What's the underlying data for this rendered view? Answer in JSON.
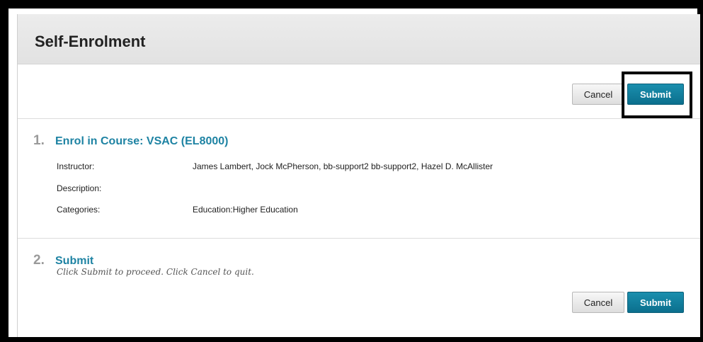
{
  "page": {
    "title": "Self-Enrolment"
  },
  "top_actions": {
    "cancel_label": "Cancel",
    "submit_label": "Submit"
  },
  "step1": {
    "number": "1.",
    "title": "Enrol in Course: VSAC (EL8000)",
    "fields": [
      {
        "label": "Instructor:",
        "value": "James Lambert, Jock McPherson, bb-support2 bb-support2, Hazel D. McAllister"
      },
      {
        "label": "Description:",
        "value": ""
      },
      {
        "label": "Categories:",
        "value": "Education:Higher Education"
      }
    ]
  },
  "step2": {
    "number": "2.",
    "title": "Submit",
    "instructions": "Click Submit to proceed. Click Cancel to quit."
  },
  "bottom_actions": {
    "cancel_label": "Cancel",
    "submit_label": "Submit"
  },
  "colors": {
    "accent": "#1e83a3",
    "submit_bg": "#0b6f8d",
    "highlight": "#000000"
  }
}
